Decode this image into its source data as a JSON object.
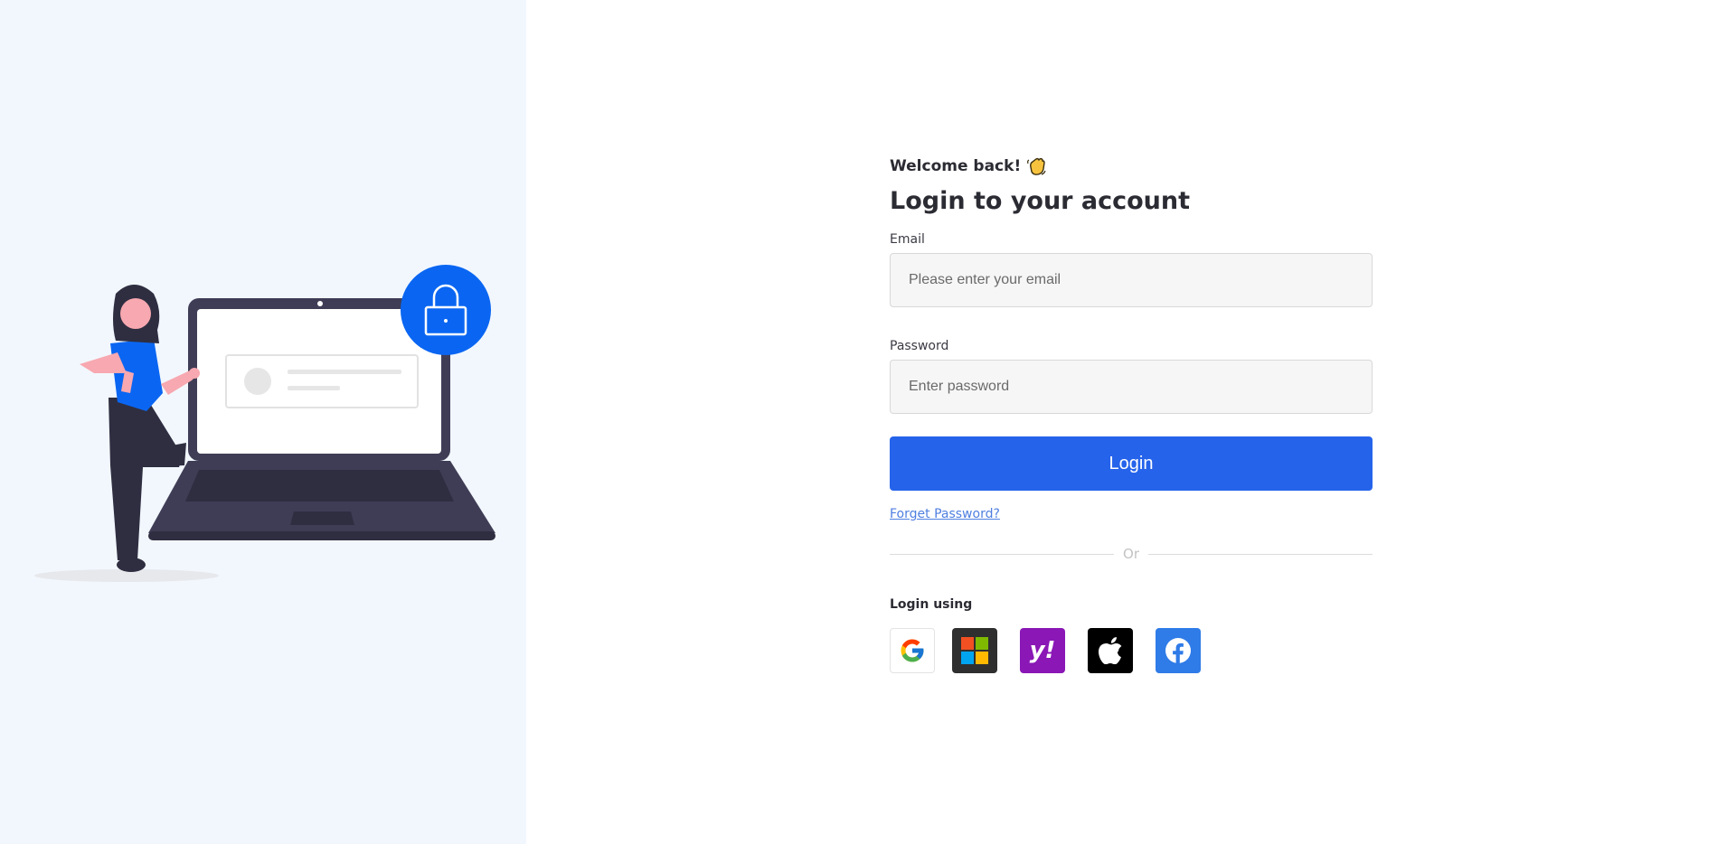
{
  "form": {
    "welcome": "Welcome back!",
    "title": "Login to your account",
    "email_label": "Email",
    "email_placeholder": "Please enter your email",
    "email_value": "",
    "password_label": "Password",
    "password_placeholder": "Enter password",
    "password_value": "",
    "login_label": "Login",
    "forgot_label": "Forget Password?",
    "divider_text": "Or",
    "login_using_label": "Login using"
  },
  "socials": [
    {
      "name": "google-icon",
      "bg": "#ffffff"
    },
    {
      "name": "microsoft-icon",
      "bg": "#2f2f2f"
    },
    {
      "name": "yahoo-icon",
      "bg": "#8a17b6"
    },
    {
      "name": "apple-icon",
      "bg": "#000000"
    },
    {
      "name": "facebook-icon",
      "bg": "#2f7be8"
    }
  ],
  "colors": {
    "primary": "#2563eb",
    "left_panel_bg": "#f2f7fe",
    "link": "#4f7fe0",
    "lock_badge": "#0a66f2"
  },
  "social_yahoo_mark": "y!"
}
